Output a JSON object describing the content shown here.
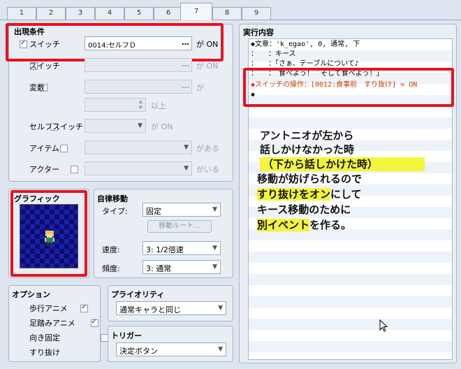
{
  "tabs": [
    "1",
    "2",
    "3",
    "4",
    "5",
    "6",
    "7",
    "8",
    "9"
  ],
  "conditions": {
    "title": "出現条件",
    "switch1": {
      "label": "スイッチ",
      "value": "0014:セルフＤ",
      "suffix": "が ON",
      "checked": true
    },
    "switch2": {
      "label": "スイッチ",
      "suffix": "が ON"
    },
    "variable": {
      "label": "変数",
      "suffix": "が",
      "suffix2": "以上"
    },
    "self_switch": {
      "label": "セルフスイッチ",
      "suffix": "が ON"
    },
    "item": {
      "label": "アイテム",
      "suffix": "がある"
    },
    "actor": {
      "label": "アクター",
      "suffix": "がいる"
    },
    "dots": "…"
  },
  "graphic": {
    "title": "グラフィック"
  },
  "movement": {
    "title": "自律移動",
    "type_label": "タイプ:",
    "type_value": "固定",
    "route_button": "移動ルート...",
    "speed_label": "速度:",
    "speed_value": "3: 1/2倍速",
    "freq_label": "頻度:",
    "freq_value": "3: 通常"
  },
  "options": {
    "title": "オプション",
    "items": [
      {
        "label": "歩行アニメ",
        "checked": true
      },
      {
        "label": "足踏みアニメ",
        "checked": true
      },
      {
        "label": "向き固定",
        "checked": false
      },
      {
        "label": "すり抜け",
        "checked": false
      }
    ]
  },
  "priority": {
    "title": "プライオリティ",
    "value": "通常キャラと同じ"
  },
  "trigger": {
    "title": "トリガー",
    "value": "決定ボタン"
  },
  "contents": {
    "title": "実行内容",
    "lines": [
      "◆文章：'k_egao', 0, 通常, 下",
      "：　　：キース",
      "：　　：「さぁ、テーブルについて♪",
      "：　　：　食べよう！　そして食べよう！」",
      "◆スイッチの操作：[0012:食事前　すり抜け] = ON",
      "◆"
    ]
  },
  "annotation": {
    "lines": [
      "アントニオが左から",
      "話しかけなかった時",
      "（下から話しかけた時）",
      "移動が妨げられるので",
      "すり抜けをオンにして",
      "キース移動のために",
      "別イベントを作る。"
    ],
    "highlight_color": "#f3f63a"
  },
  "colors": {
    "red_box": "#e5141f",
    "highlight_text": "#d43b00"
  }
}
